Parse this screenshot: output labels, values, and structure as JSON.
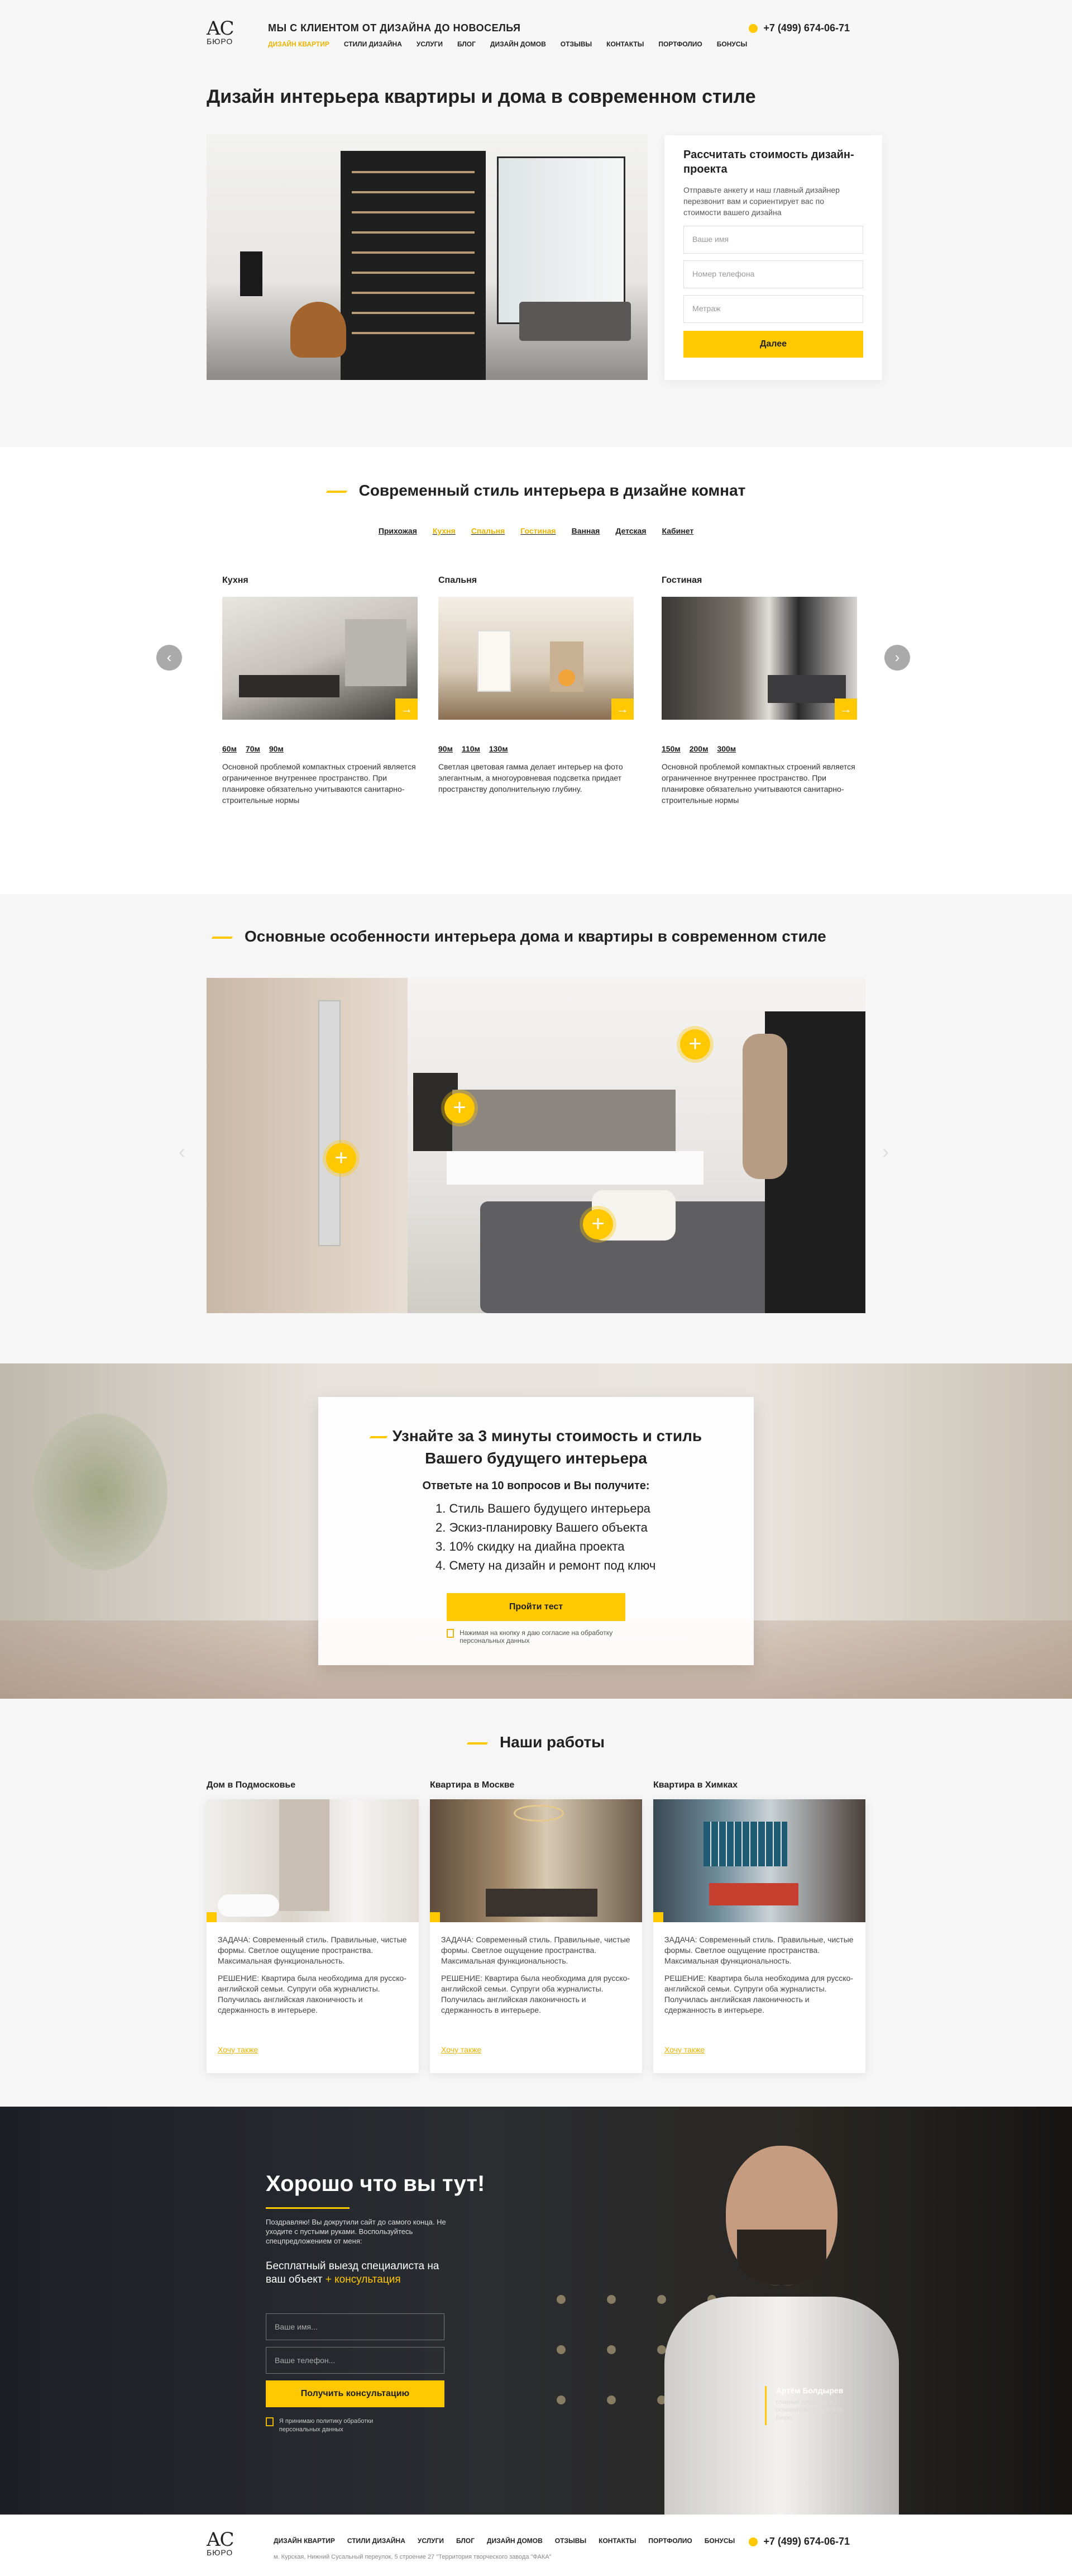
{
  "header": {
    "logo": {
      "mark": "AC",
      "name": "БЮРО"
    },
    "tagline": "МЫ С КЛИЕНТОМ ОТ ДИЗАЙНА ДО НОВОСЕЛЬЯ",
    "nav": [
      "ДИЗАЙН КВАРТИР",
      "СТИЛИ ДИЗАЙНА",
      "УСЛУГИ",
      "БЛОГ",
      "ДИЗАЙН ДОМОВ",
      "ОТЗЫВЫ",
      "КОНТАКТЫ",
      "ПОРТФОЛИО",
      "БОНУСЫ"
    ],
    "phone": "+7 (499) 674-06-71"
  },
  "hero": {
    "title": "Дизайн интерьера квартиры и дома в современном стиле",
    "form": {
      "title": "Рассчитать стоимость дизайн-проекта",
      "text": "Отправьте анкету и наш главный дизайнер перезвонит вам и сориентирует вас по стоимости вашего дизайна",
      "name_placeholder": "Ваше имя",
      "phone_placeholder": "Номер телефона",
      "area_placeholder": "Метраж",
      "submit": "Далее"
    }
  },
  "styles": {
    "title": "Современный стиль интерьера в дизайне комнат",
    "tabs": [
      "Прихожая",
      "Кухня",
      "Спальня",
      "Гостиная",
      "Ванная",
      "Детская",
      "Кабинет"
    ],
    "rooms": [
      {
        "name": "Кухня",
        "sizes": [
          "60м",
          "70м",
          "90м"
        ],
        "desc": "Основной проблемой компактных строений является ограниченное внутреннее пространство. При планировке обязательно учитываются санитарно-строительные нормы"
      },
      {
        "name": "Спальня",
        "sizes": [
          "90м",
          "110м",
          "130м"
        ],
        "desc": "Светлая цветовая гамма делает интерьер на фото элегантным, а многоуровневая подсветка придает пространству дополнительную глубину."
      },
      {
        "name": "Гостиная",
        "sizes": [
          "150м",
          "200м",
          "300м"
        ],
        "desc": "Основной проблемой компактных строений является ограниченное внутреннее пространство. При планировке обязательно учитываются санитарно-строительные нормы"
      }
    ]
  },
  "features": {
    "title": "Основные особенности интерьера дома и квартиры в современном стиле"
  },
  "quiz": {
    "title": "Узнайте за 3 минуты стоимость и стиль Вашего будущего интерьера",
    "subtitle": "Ответьте на 10 вопросов и Вы получите:",
    "items": [
      "1. Стиль Вашего будущего интерьера",
      "2. Эскиз-планировку Вашего объекта",
      "3. 10% скидку на диайна проекта",
      "4. Смету на дизайн и ремонт под ключ"
    ],
    "button": "Пройти тест",
    "consent": "Нажимая на кнопку я даю согласие на обработку персональных данных"
  },
  "works": {
    "title": "Наши работы",
    "items": [
      {
        "title": "Дом в Подмосковье",
        "task": "ЗАДАЧА: Современный стиль. Правильные, чистые формы. Светлое ощущение пространства. Максимальная функциональность.",
        "solution": "РЕШЕНИЕ: Квартира была необходима для русско-английской семьи. Супруги оба журналисты. Получилась английская лаконичность и сдержанность в интерьере.",
        "more": "Хочу также"
      },
      {
        "title": "Квартира в Москве",
        "task": "ЗАДАЧА: Современный стиль. Правильные, чистые формы. Светлое ощущение пространства. Максимальная функциональность.",
        "solution": "РЕШЕНИЕ: Квартира была необходима для русско-английской семьи. Супруги оба журналисты. Получилась английская лаконичность и сдержанность в интерьере.",
        "more": "Хочу также"
      },
      {
        "title": "Квартира в Химках",
        "task": "ЗАДАЧА: Современный стиль. Правильные, чистые формы. Светлое ощущение пространства. Максимальная функциональность.",
        "solution": "РЕШЕНИЕ: Квартира была необходима для русско-английской семьи. Супруги оба журналисты. Получилась английская лаконичность и сдержанность в интерьере.",
        "more": "Хочу также"
      }
    ]
  },
  "contact": {
    "title": "Хорошо что вы тут!",
    "text": "Поздравляю! Вы докрутили сайт до самого конца. Не уходите с пустыми руками. Воспользуйтесь спецпредложением от меня:",
    "offer": "Бесплатный выезд специалиста на ваш объект",
    "offer_accent": "+ консультация",
    "name_placeholder": "Ваше имя...",
    "phone_placeholder": "Ваше телефон...",
    "button": "Получить консультацию",
    "consent": "Я принимаю политику обработки персональных данных",
    "person_name": "Артём Болдырев",
    "person_role": "главный дизайнер и основатель студии \"АС Бюро\""
  },
  "footer": {
    "nav": [
      "ДИЗАЙН КВАРТИР",
      "СТИЛИ ДИЗАЙНА",
      "УСЛУГИ",
      "БЛОГ",
      "ДИЗАЙН ДОМОВ",
      "ОТЗЫВЫ",
      "КОНТАКТЫ",
      "ПОРТФОЛИО",
      "БОНУСЫ"
    ],
    "address": "м. Курская, Нижний Сусальный переулок, 5 строение 27 \"Территория творческого завода \"ФАКА\"",
    "phone": "+7 (499) 674-06-71"
  },
  "colors": {
    "accent": "#ffc800",
    "dark": "#20242a",
    "text": "#222222"
  }
}
